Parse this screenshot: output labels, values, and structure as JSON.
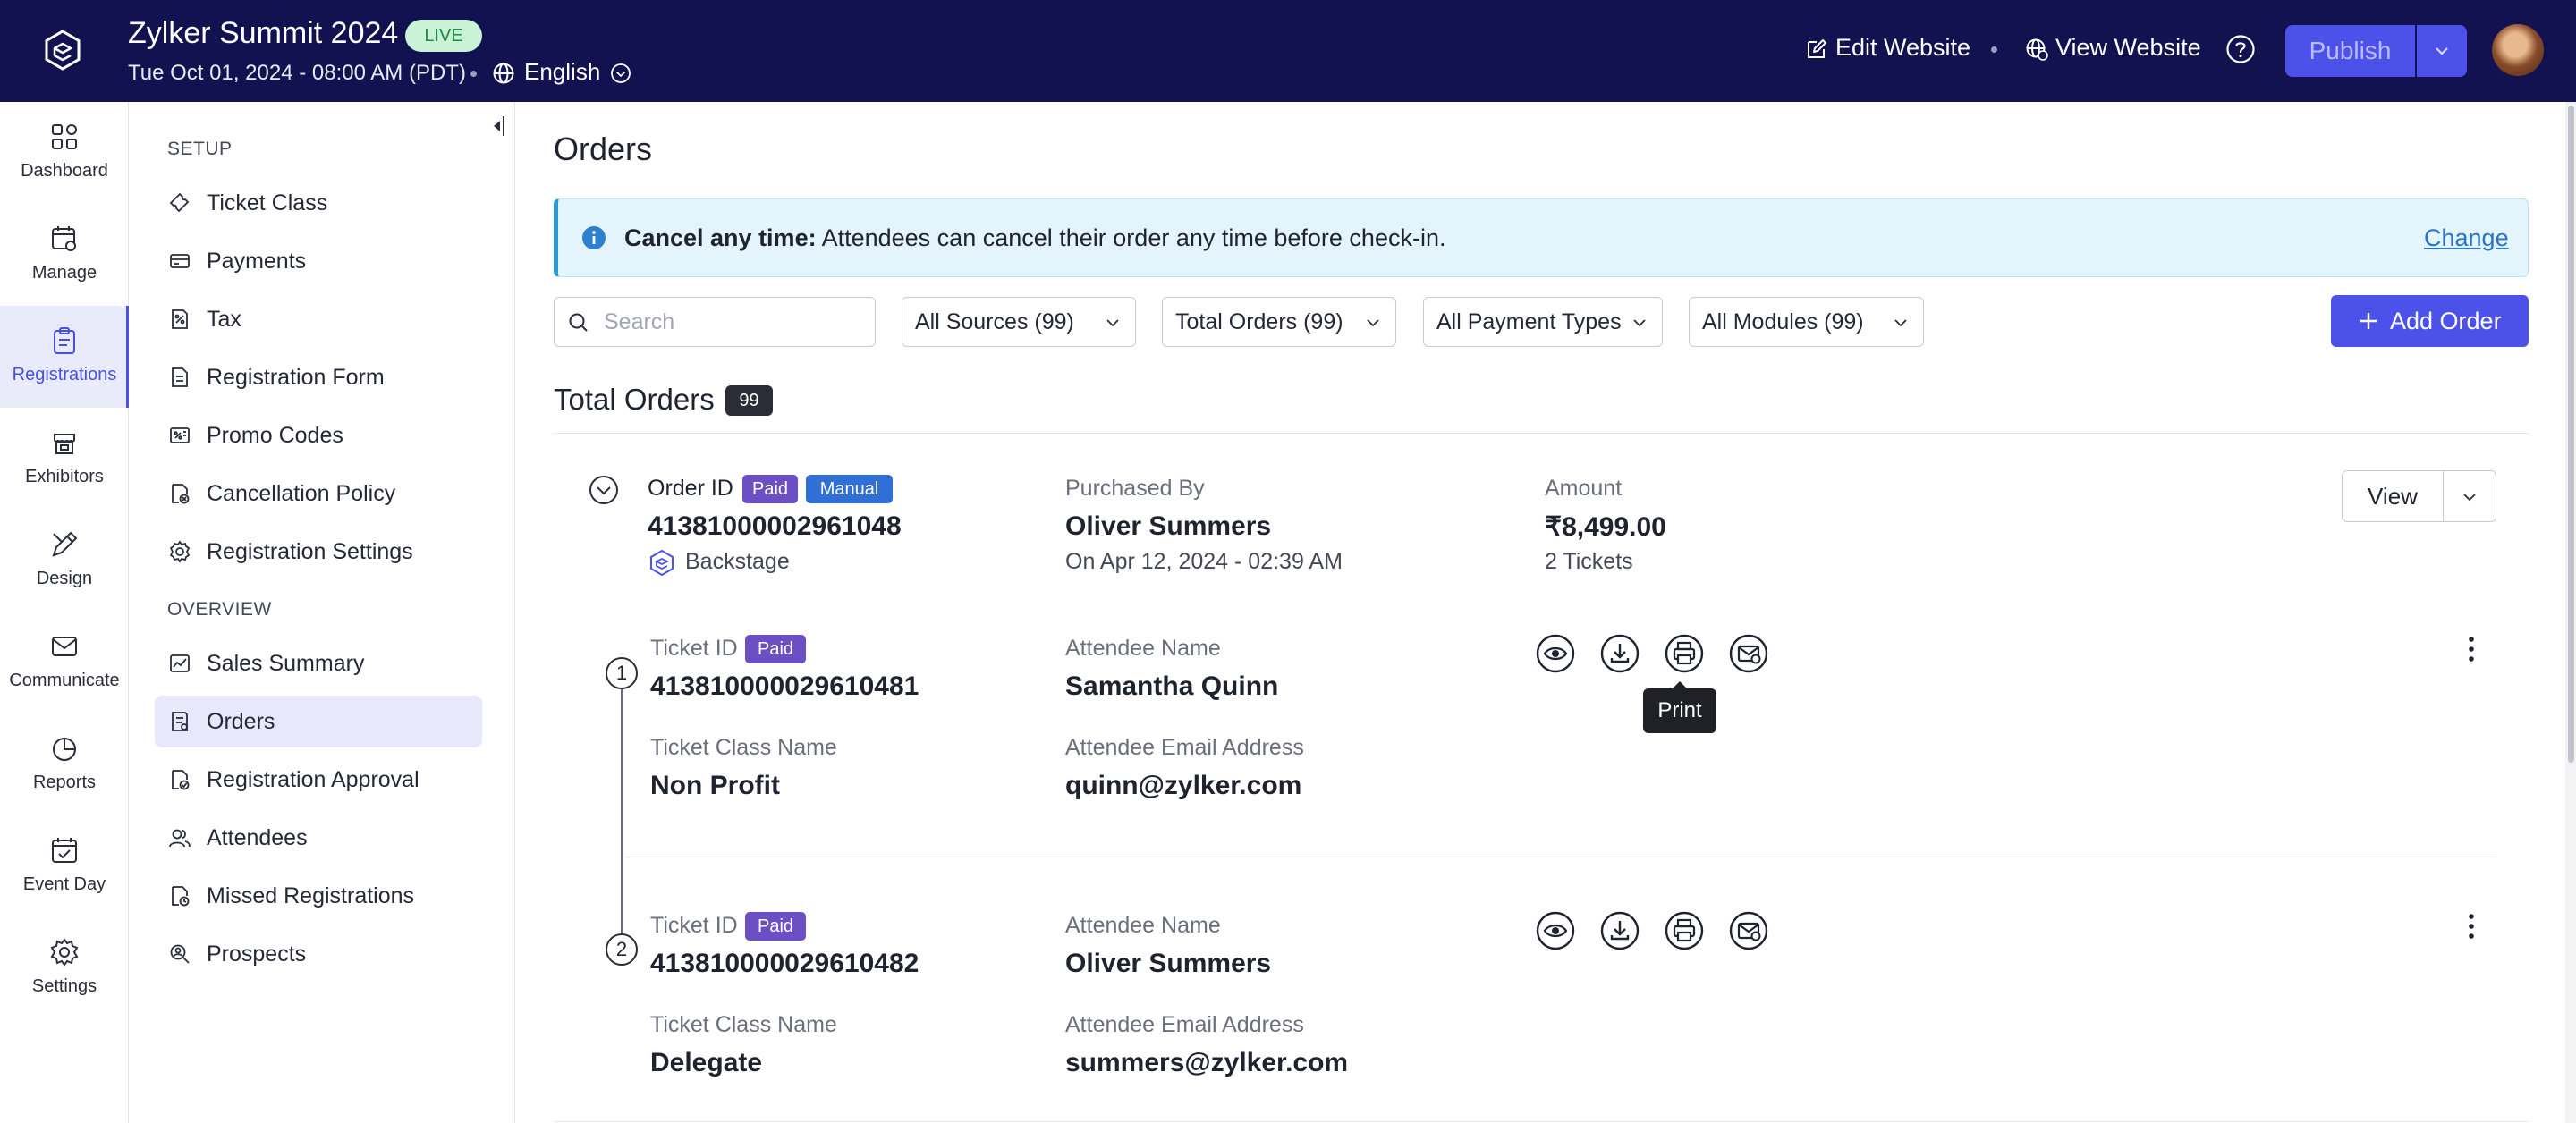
{
  "header": {
    "event_title": "Zylker Summit 2024",
    "live_badge": "LIVE",
    "event_date": "Tue Oct 01, 2024 - 08:00 AM (PDT)",
    "language": "English",
    "edit_website": "Edit Website",
    "view_website": "View Website",
    "publish": "Publish"
  },
  "rail": {
    "items": [
      {
        "label": "Dashboard",
        "icon": "dashboard-icon"
      },
      {
        "label": "Manage",
        "icon": "manage-icon"
      },
      {
        "label": "Registrations",
        "icon": "registrations-icon",
        "active": true
      },
      {
        "label": "Exhibitors",
        "icon": "exhibitors-icon"
      },
      {
        "label": "Design",
        "icon": "design-icon"
      },
      {
        "label": "Communicate",
        "icon": "communicate-icon"
      },
      {
        "label": "Reports",
        "icon": "reports-icon"
      },
      {
        "label": "Event Day",
        "icon": "event-day-icon"
      },
      {
        "label": "Settings",
        "icon": "settings-icon"
      }
    ]
  },
  "sidebar": {
    "setup_heading": "SETUP",
    "setup_items": [
      {
        "label": "Ticket Class",
        "icon": "ticket-icon"
      },
      {
        "label": "Payments",
        "icon": "payments-icon"
      },
      {
        "label": "Tax",
        "icon": "tax-icon"
      },
      {
        "label": "Registration Form",
        "icon": "form-icon"
      },
      {
        "label": "Promo Codes",
        "icon": "promo-icon"
      },
      {
        "label": "Cancellation Policy",
        "icon": "cancellation-icon"
      },
      {
        "label": "Registration Settings",
        "icon": "gear-icon"
      }
    ],
    "overview_heading": "OVERVIEW",
    "overview_items": [
      {
        "label": "Sales Summary",
        "icon": "sales-icon"
      },
      {
        "label": "Orders",
        "icon": "orders-icon",
        "active": true
      },
      {
        "label": "Registration Approval",
        "icon": "approval-icon"
      },
      {
        "label": "Attendees",
        "icon": "attendees-icon"
      },
      {
        "label": "Missed Registrations",
        "icon": "missed-icon"
      },
      {
        "label": "Prospects",
        "icon": "prospects-icon"
      }
    ]
  },
  "main": {
    "title": "Orders",
    "banner": {
      "bold": "Cancel any time:",
      "text": " Attendees can cancel their order any time before check-in.",
      "link": "Change"
    },
    "search_placeholder": "Search",
    "filters": [
      "All Sources (99)",
      "Total Orders (99)",
      "All Payment Types",
      "All Modules (99)"
    ],
    "add_order": "Add Order",
    "total_label": "Total Orders",
    "total_count": "99",
    "order": {
      "id_label": "Order ID",
      "badge_paid": "Paid",
      "badge_manual": "Manual",
      "id": "413810000029610 48",
      "id_text": "413810000029610 48",
      "source": "Backstage",
      "purchased_by_label": "Purchased By",
      "purchased_by": "Oliver Summers",
      "purchased_on": "On Apr 12, 2024 - 02:39 AM",
      "amount_label": "Amount",
      "amount": "₹8,499.00",
      "tickets": "2 Tickets",
      "view": "View"
    },
    "tickets": [
      {
        "num": "1",
        "id_label": "Ticket ID",
        "badge": "Paid",
        "id": "413810000029610481",
        "class_label": "Ticket Class Name",
        "class": "Non Profit",
        "name_label": "Attendee Name",
        "name": "Samantha Quinn",
        "email_label": "Attendee Email Address",
        "email": "quinn@zylker.com"
      },
      {
        "num": "2",
        "id_label": "Ticket ID",
        "badge": "Paid",
        "id": "413810000029610482",
        "class_label": "Ticket Class Name",
        "class": "Delegate",
        "name_label": "Attendee Name",
        "name": "Oliver Summers",
        "email_label": "Attendee Email Address",
        "email": "summers@zylker.com"
      }
    ],
    "tooltip": "Print"
  }
}
